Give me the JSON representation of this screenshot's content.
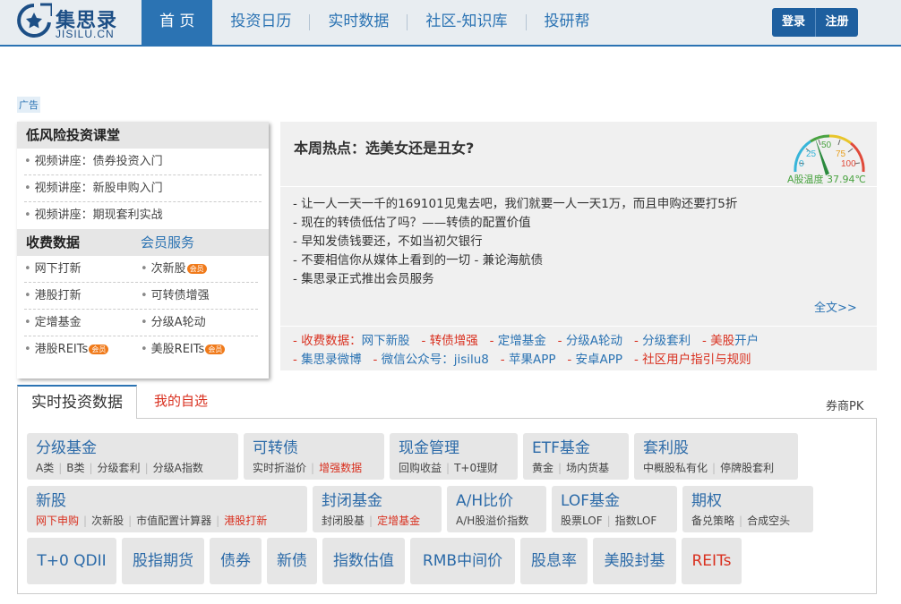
{
  "header": {
    "logo_cn": "集思录",
    "logo_en": "JISILU.CN",
    "nav": [
      "首 页",
      "投资日历",
      "实时数据",
      "社区-知识库",
      "投研帮"
    ],
    "login": "登录",
    "register": "注册"
  },
  "ad_label": "广告",
  "course": {
    "title": "低风险投资课堂",
    "items": [
      "视频讲座：债券投资入门",
      "视频讲座：新股申购入门",
      "视频讲座：期现套利实战"
    ]
  },
  "paid": {
    "title": "收费数据",
    "member": "会员服务",
    "vip_badge": "会员",
    "rows": [
      [
        "网下打新",
        "次新股"
      ],
      [
        "港股打新",
        "可转债增强"
      ],
      [
        "定增基金",
        "分级A轮动"
      ],
      [
        "港股REITs",
        "美股REITs"
      ]
    ]
  },
  "hot": {
    "title": "本周热点：选美女还是丑女?",
    "gauge": {
      "ticks": [
        "0",
        "25",
        "50",
        "75",
        "100"
      ],
      "label": "A股温度 37.94℃",
      "value": 37.94
    },
    "lines": [
      "- 让一人一天一千的169101见鬼去吧，我们就要一人一天1万，而且申购还要打5折",
      "- 现在的转债低估了吗？——转债的配置价值",
      "- 早知发债钱要还，不如当初欠银行",
      "- 不要相信你从媒体上看到的一切 - 兼论海航债",
      "- 集思录正式推出会员服务"
    ],
    "more": "全文>>",
    "links_row1": [
      "收费数据：",
      "网下新股",
      "转债增强",
      "定增基金",
      "分级A轮动",
      "分级套利",
      "美股",
      "开户"
    ],
    "links_row2": [
      "集思录微博",
      "微信公众号：jisilu8",
      "苹果APP",
      "安卓APP",
      "社区用户指引与规则"
    ]
  },
  "data_panel": {
    "tab_realtime": "实时投资数据",
    "tab_watch": "我的自选",
    "pk": "券商PK",
    "tiles": [
      {
        "title": "分级基金",
        "subs": [
          "A类",
          "B类",
          "分级套利",
          "分级A指数"
        ]
      },
      {
        "title": "可转债",
        "subs": [
          "实时折溢价",
          "增强数据"
        ]
      },
      {
        "title": "现金管理",
        "subs": [
          "回购收益",
          "T+0理财"
        ]
      },
      {
        "title": "ETF基金",
        "subs": [
          "黄金",
          "场内货基"
        ]
      },
      {
        "title": "套利股",
        "subs": [
          "中概股私有化",
          "停牌股套利"
        ]
      },
      {
        "title": "新股",
        "subs": [
          "网下申购",
          "次新股",
          "市值配置计算器",
          "港股打新"
        ]
      },
      {
        "title": "封闭基金",
        "subs": [
          "封闭股基",
          "定增基金"
        ]
      },
      {
        "title": "A/H比价",
        "subs": [
          "A/H股溢价指数"
        ]
      },
      {
        "title": "LOF基金",
        "subs": [
          "股票LOF",
          "指数LOF"
        ]
      },
      {
        "title": "期权",
        "subs": [
          "备兑策略",
          "合成空头"
        ]
      }
    ],
    "big_tiles": [
      "T+0 QDII",
      "股指期货",
      "债券",
      "新债",
      "指数估值",
      "RMB中间价",
      "股息率",
      "美股封基",
      "REITs"
    ]
  }
}
